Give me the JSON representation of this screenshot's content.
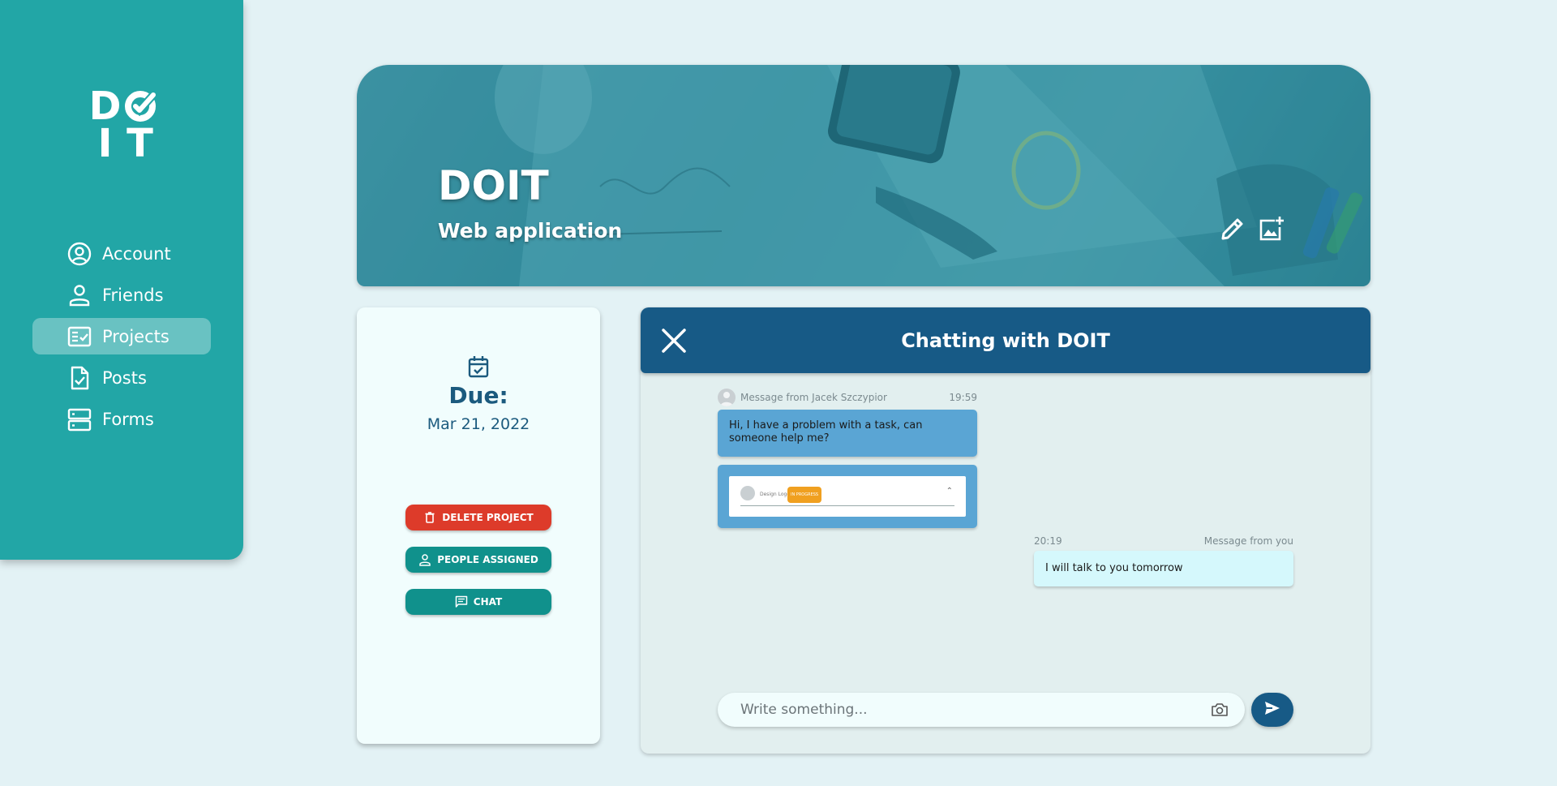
{
  "sidebar": {
    "logo": {
      "row1": "D",
      "row2a": "I",
      "row2b": "T",
      "check_icon": "check-o-icon"
    },
    "items": [
      {
        "label": "Account",
        "icon": "account-circle-icon"
      },
      {
        "label": "Friends",
        "icon": "person-icon"
      },
      {
        "label": "Projects",
        "icon": "projects-checklist-icon",
        "active": true
      },
      {
        "label": "Posts",
        "icon": "document-check-icon"
      },
      {
        "label": "Forms",
        "icon": "forms-icon"
      }
    ]
  },
  "banner": {
    "title": "DOIT",
    "subtitle": "Web application",
    "edit_icon": "pencil-icon",
    "add_image_icon": "add-image-icon"
  },
  "project": {
    "due_label": "Due:",
    "due_date": "Mar 21, 2022",
    "buttons": {
      "delete": "DELETE PROJECT",
      "people": "PEOPLE ASSIGNED",
      "chat": "CHAT"
    }
  },
  "chat": {
    "title": "Chatting with DOIT",
    "messages": [
      {
        "from": "Message from Jacek Szczypior",
        "time": "19:59",
        "text": "Hi, I have a problem with a task, can someone help me?",
        "attachment": {
          "title": "Design Logo",
          "badge": "IN PROGRESS"
        }
      },
      {
        "from": "Message from you",
        "time": "20:19",
        "text": "I will talk to you tomorrow"
      }
    ],
    "input": {
      "placeholder": "Write something...",
      "value": ""
    }
  },
  "colors": {
    "sidebar": "#22a6a6",
    "header": "#175a86",
    "danger": "#dd3b2a",
    "teal": "#10918c",
    "background": "#e3f2f5"
  }
}
